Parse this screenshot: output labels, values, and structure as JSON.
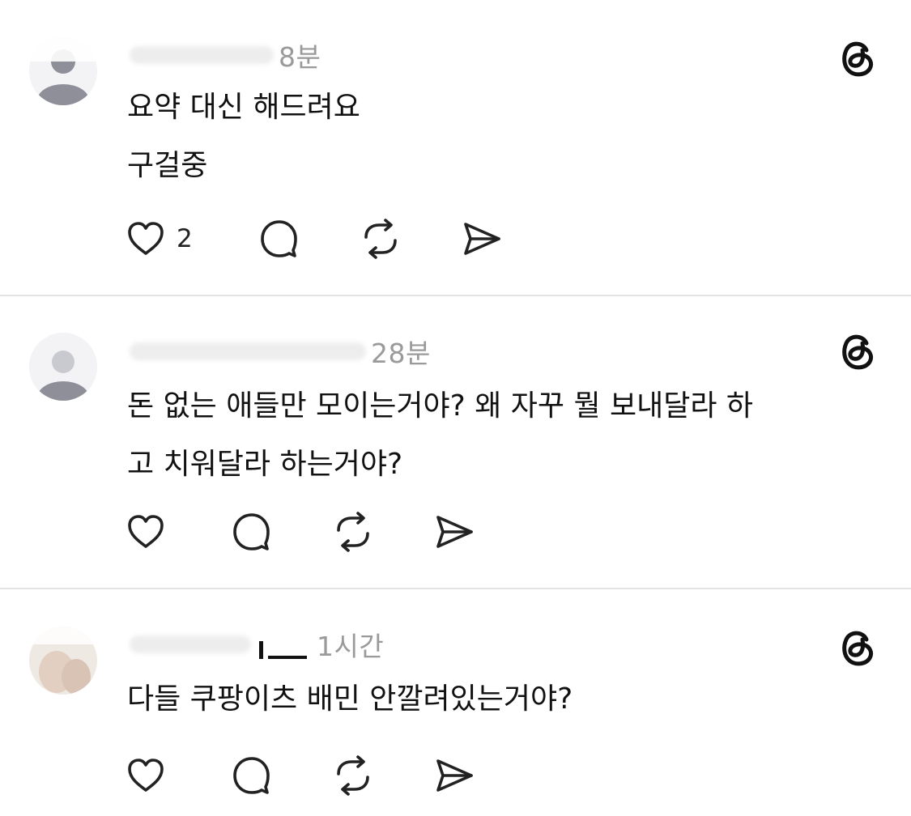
{
  "posts": [
    {
      "time": "8분",
      "text": "요약 대신 해드려요\n구걸중",
      "like_count": "2"
    },
    {
      "time": "28분",
      "text": "돈 없는 애들만 모이는거야? 왜 자꾸 뭘 보내달라 하\n고 치워달라 하는거야?",
      "like_count": ""
    },
    {
      "time": "1시간",
      "text": "다들 쿠팡이츠 배민 안깔려있는거야?",
      "like_count": ""
    }
  ],
  "icons": {
    "like": "heart-icon",
    "reply": "comment-icon",
    "repost": "repost-icon",
    "share": "send-icon",
    "brand": "threads-logo-icon"
  },
  "colors": {
    "text": "#111111",
    "timestamp": "#9a9a9a",
    "divider": "#e3e3e3",
    "icon": "#222222"
  }
}
